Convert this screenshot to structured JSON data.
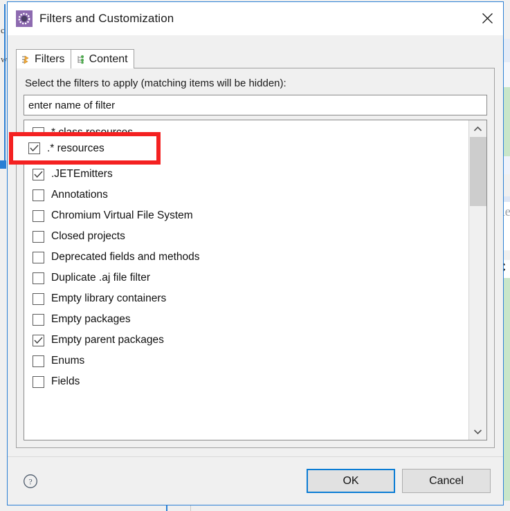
{
  "window": {
    "title": "Filters and Customization",
    "icon": "filters-customization-icon",
    "close_label": "✕",
    "accent_color": "#2a7fd4"
  },
  "tabs": [
    {
      "label": "Filters",
      "icon": "filter-arrow-icon",
      "active": true
    },
    {
      "label": "Content",
      "icon": "content-tree-icon",
      "active": false
    }
  ],
  "filters_tab": {
    "instruction": "Select the filters to apply (matching items will be hidden):",
    "search": {
      "value": "enter name of filter",
      "placeholder": "enter name of filter",
      "name": "filter-name-input"
    },
    "items": [
      {
        "label": "* class resources",
        "checked": false
      },
      {
        "label": ".* resources",
        "checked": true,
        "highlighted": true
      },
      {
        "label": ".JETEmitters",
        "checked": true
      },
      {
        "label": "Annotations",
        "checked": false
      },
      {
        "label": "Chromium Virtual File System",
        "checked": false
      },
      {
        "label": "Closed projects",
        "checked": false
      },
      {
        "label": "Deprecated fields and methods",
        "checked": false
      },
      {
        "label": "Duplicate .aj file filter",
        "checked": false
      },
      {
        "label": "Empty library containers",
        "checked": false
      },
      {
        "label": "Empty packages",
        "checked": false
      },
      {
        "label": "Empty parent packages",
        "checked": true
      },
      {
        "label": "Enums",
        "checked": false
      },
      {
        "label": "Fields",
        "checked": false
      }
    ],
    "scrollbar": {
      "up_arrow": "scroll-up-icon",
      "down_arrow": "scroll-down-icon",
      "thumb_color": "#cdcdcd"
    }
  },
  "footer": {
    "help_icon": "help-question-icon",
    "ok_label": "OK",
    "cancel_label": "Cancel",
    "focus_color": "#0a7cd4"
  },
  "annotation": {
    "type": "red-rectangle-highlight",
    "color": "#f42121",
    "targets_item": ".* resources",
    "checked": true
  },
  "background": {
    "left_letters": [
      "c",
      "w"
    ],
    "right_texts": [
      "Re",
      "C"
    ],
    "accent_color": "#2a7fd4",
    "green_panel_color": "#c8e6c9"
  }
}
